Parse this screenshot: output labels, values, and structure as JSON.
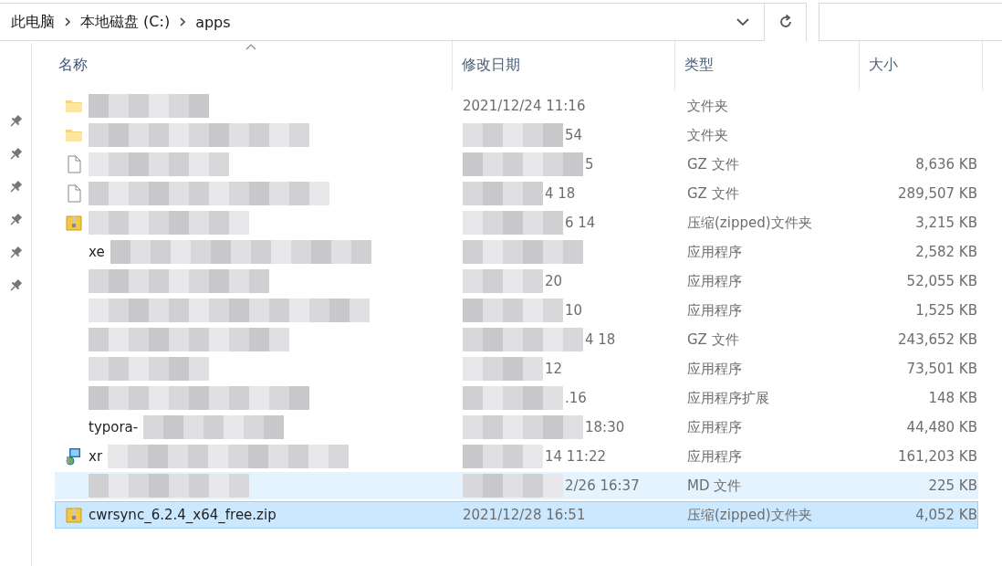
{
  "address_bar": {
    "path": [
      "此电脑",
      "本地磁盘 (C:)",
      "apps"
    ]
  },
  "columns": [
    {
      "label": "名称",
      "sorted": true
    },
    {
      "label": "修改日期",
      "sorted": false
    },
    {
      "label": "类型",
      "sorted": false
    },
    {
      "label": "大小",
      "sorted": false
    }
  ],
  "rows": [
    {
      "kind": "folder",
      "name": "",
      "name_redacted": true,
      "date": "2021/12/24 11:16",
      "date_redacted": false,
      "type": "文件夹",
      "size": "",
      "selected": false,
      "hovered": false
    },
    {
      "kind": "folder",
      "name": "",
      "name_redacted": true,
      "date": "54",
      "date_redacted": true,
      "type": "文件夹",
      "size": "",
      "selected": false,
      "hovered": false
    },
    {
      "kind": "file",
      "name": "",
      "name_redacted": true,
      "date": "5",
      "date_redacted": true,
      "type": "GZ 文件",
      "size": "8,636 KB",
      "selected": false,
      "hovered": false
    },
    {
      "kind": "file",
      "name": "",
      "name_redacted": true,
      "date": "4 18",
      "date_redacted": true,
      "type": "GZ 文件",
      "size": "289,507 KB",
      "selected": false,
      "hovered": false
    },
    {
      "kind": "zip",
      "name": "",
      "name_redacted": true,
      "date": "6 14",
      "date_redacted": true,
      "type": "压缩(zipped)文件夹",
      "size": "3,215 KB",
      "selected": false,
      "hovered": false
    },
    {
      "kind": "hidden",
      "name": "xe",
      "name_redacted": true,
      "date": "",
      "date_redacted": true,
      "type": "应用程序",
      "size": "2,582 KB",
      "selected": false,
      "hovered": false
    },
    {
      "kind": "hidden",
      "name": "",
      "name_redacted": true,
      "date": "20",
      "date_redacted": true,
      "type": "应用程序",
      "size": "52,055 KB",
      "selected": false,
      "hovered": false
    },
    {
      "kind": "hidden",
      "name": "",
      "name_redacted": true,
      "date": "10",
      "date_redacted": true,
      "type": "应用程序",
      "size": "1,525 KB",
      "selected": false,
      "hovered": false
    },
    {
      "kind": "hidden",
      "name": "",
      "name_redacted": true,
      "date": "4 18",
      "date_redacted": true,
      "type": "GZ 文件",
      "size": "243,652 KB",
      "selected": false,
      "hovered": false
    },
    {
      "kind": "hidden",
      "name": "",
      "name_redacted": true,
      "date": "12",
      "date_redacted": true,
      "type": "应用程序",
      "size": "73,501 KB",
      "selected": false,
      "hovered": false
    },
    {
      "kind": "hidden",
      "name": "",
      "name_redacted": true,
      "date": ".16",
      "date_redacted": true,
      "type": "应用程序扩展",
      "size": "148 KB",
      "selected": false,
      "hovered": false
    },
    {
      "kind": "hidden",
      "name": "typora-",
      "name_redacted": true,
      "date": "18:30",
      "date_redacted": true,
      "type": "应用程序",
      "size": "44,480 KB",
      "selected": false,
      "hovered": false
    },
    {
      "kind": "installer",
      "name": "xr",
      "name_redacted": true,
      "date": "14 11:22",
      "date_redacted": true,
      "type": "应用程序",
      "size": "161,203 KB",
      "selected": false,
      "hovered": false
    },
    {
      "kind": "hidden",
      "name": "",
      "name_redacted": true,
      "date": "2/26 16:37",
      "date_redacted": true,
      "type": "MD 文件",
      "size": "225 KB",
      "selected": false,
      "hovered": true
    },
    {
      "kind": "zip",
      "name": "cwrsync_6.2.4_x64_free.zip",
      "name_redacted": false,
      "date": "2021/12/28 16:51",
      "date_redacted": false,
      "type": "压缩(zipped)文件夹",
      "size": "4,052 KB",
      "selected": true,
      "hovered": false
    }
  ]
}
